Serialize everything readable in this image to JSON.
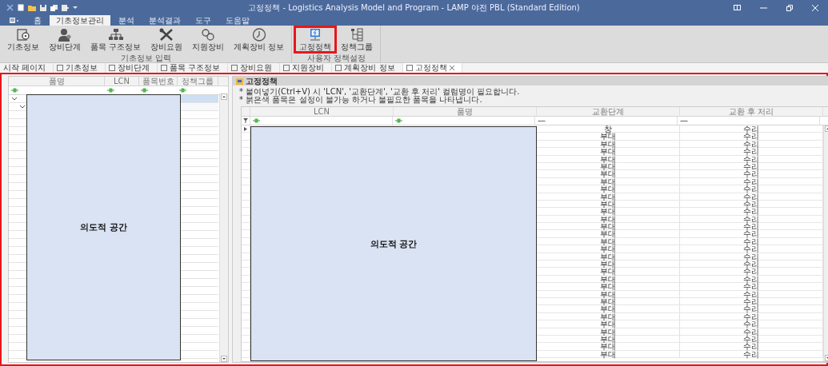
{
  "window": {
    "title": "고정정책 - Logistics Analysis Model and Program - LAMP 야전 PBL (Standard Edition)"
  },
  "ribbon_tabs": [
    {
      "label": "홈",
      "selected": false
    },
    {
      "label": "기초정보관리",
      "selected": true
    },
    {
      "label": "분석",
      "selected": false
    },
    {
      "label": "분석결과",
      "selected": false
    },
    {
      "label": "도구",
      "selected": false
    },
    {
      "label": "도움말",
      "selected": false
    }
  ],
  "ribbon_groups": [
    {
      "label": "기초정보 입력",
      "buttons": [
        {
          "label": "기초정보",
          "highlighted": false
        },
        {
          "label": "장비단계",
          "highlighted": false
        },
        {
          "label": "품목 구조정보",
          "highlighted": false
        },
        {
          "label": "장비요원",
          "highlighted": false
        },
        {
          "label": "지원장비",
          "highlighted": false
        },
        {
          "label": "계획장비 정보",
          "highlighted": false
        }
      ]
    },
    {
      "label": "사용자 정책설정",
      "buttons": [
        {
          "label": "고정정책",
          "highlighted": true
        },
        {
          "label": "정책그룹",
          "highlighted": false
        }
      ]
    }
  ],
  "doc_tabs": [
    {
      "label": "시작 페이지",
      "selected": false
    },
    {
      "label": "기초정보",
      "selected": false
    },
    {
      "label": "장비단계",
      "selected": false
    },
    {
      "label": "품목 구조정보",
      "selected": false
    },
    {
      "label": "장비요원",
      "selected": false
    },
    {
      "label": "지원장비",
      "selected": false
    },
    {
      "label": "계획장비 정보",
      "selected": false
    },
    {
      "label": "고정정책",
      "selected": true
    }
  ],
  "workspace": {
    "highlighted": true
  },
  "left_panel": {
    "columns": [
      "품명",
      "LCN",
      "품목번호",
      "정책그룹"
    ],
    "rows": [
      {
        "selected": true,
        "expanded": true
      },
      {
        "selected": false,
        "expanded": true
      }
    ],
    "overlay_text": "의도적 공간"
  },
  "right_panel": {
    "title": "고정정책",
    "notes": [
      "* 붙여넣기(Ctrl+V) 시 'LCN', '교환단계', '교환 후 처리' 컬럼명이 필요합니다.",
      "* 붉은색 품목은 설정이 불가능 하거나 불필요한 품목을 나타냅니다."
    ],
    "columns": [
      "LCN",
      "품명",
      "교환단계",
      "교환 후 처리"
    ],
    "filters": [
      "—",
      "—"
    ],
    "rows": [
      {
        "exchange_stage": "창",
        "after_exchange": "수리"
      },
      {
        "exchange_stage": "부대",
        "after_exchange": "수리"
      },
      {
        "exchange_stage": "부대",
        "after_exchange": "수리"
      },
      {
        "exchange_stage": "부대",
        "after_exchange": "수리"
      },
      {
        "exchange_stage": "부대",
        "after_exchange": "수리"
      },
      {
        "exchange_stage": "부대",
        "after_exchange": "수리"
      },
      {
        "exchange_stage": "부대",
        "after_exchange": "수리"
      },
      {
        "exchange_stage": "부대",
        "after_exchange": "수리"
      },
      {
        "exchange_stage": "부대",
        "after_exchange": "수리"
      },
      {
        "exchange_stage": "부대",
        "after_exchange": "수리"
      },
      {
        "exchange_stage": "부대",
        "after_exchange": "수리"
      },
      {
        "exchange_stage": "부대",
        "after_exchange": "수리"
      },
      {
        "exchange_stage": "부대",
        "after_exchange": "수리"
      },
      {
        "exchange_stage": "부대",
        "after_exchange": "수리"
      },
      {
        "exchange_stage": "부대",
        "after_exchange": "수리"
      },
      {
        "exchange_stage": "부대",
        "after_exchange": "수리"
      },
      {
        "exchange_stage": "부대",
        "after_exchange": "수리"
      },
      {
        "exchange_stage": "부대",
        "after_exchange": "수리"
      },
      {
        "exchange_stage": "부대",
        "after_exchange": "수리"
      },
      {
        "exchange_stage": "부대",
        "after_exchange": "수리"
      },
      {
        "exchange_stage": "부대",
        "after_exchange": "수리"
      },
      {
        "exchange_stage": "부대",
        "after_exchange": "수리"
      },
      {
        "exchange_stage": "부대",
        "after_exchange": "수리"
      },
      {
        "exchange_stage": "부대",
        "after_exchange": "수리"
      },
      {
        "exchange_stage": "부대",
        "after_exchange": "수리"
      },
      {
        "exchange_stage": "부대",
        "after_exchange": "수리"
      },
      {
        "exchange_stage": "부대",
        "after_exchange": "수리"
      },
      {
        "exchange_stage": "부대",
        "after_exchange": "수리"
      },
      {
        "exchange_stage": "부대",
        "after_exchange": "수리"
      },
      {
        "exchange_stage": "부대",
        "after_exchange": "수리"
      },
      {
        "exchange_stage": "부대",
        "after_exchange": "수리"
      }
    ],
    "overlay_text": "의도적 공간"
  }
}
